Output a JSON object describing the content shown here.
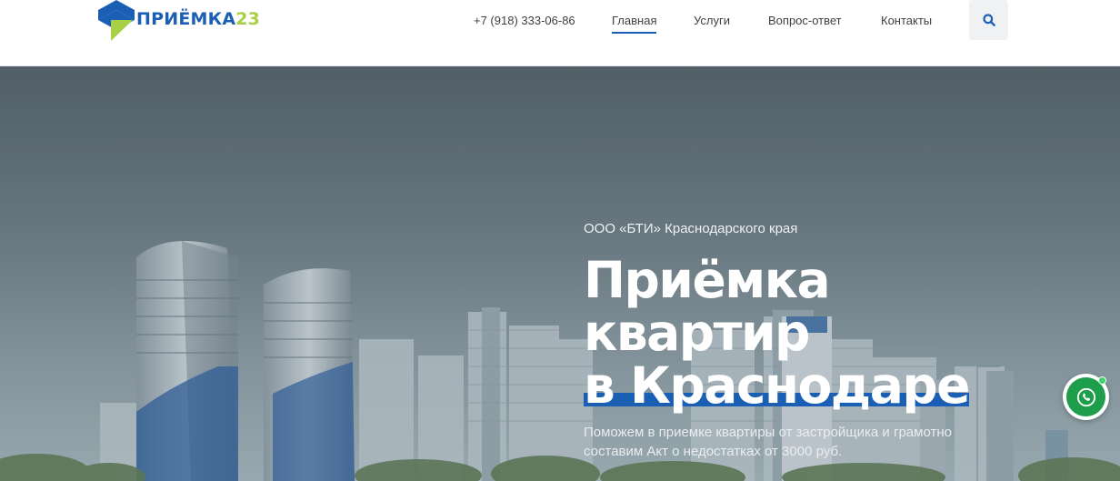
{
  "header": {
    "logo": {
      "word": "ПРИЁМКА",
      "number": "23"
    },
    "phone": "+7 (918) 333-06-86",
    "nav": [
      {
        "label": "Главная",
        "active": true
      },
      {
        "label": "Услуги",
        "active": false
      },
      {
        "label": "Вопрос-ответ",
        "active": false
      },
      {
        "label": "Контакты",
        "active": false
      }
    ],
    "search_icon": "search-icon"
  },
  "hero": {
    "kicker": "ООО «БТИ» Краснодарского края",
    "title_line1": "Приёмка",
    "title_line2": "квартир",
    "title_line3": "в Краснодаре",
    "subtitle": "Поможем в приемке квартиры от застройщика и грамотно составим Акт о недостатках от 3000 руб."
  },
  "widgets": {
    "call_icon": "phone-icon"
  },
  "colors": {
    "brand_blue": "#1a5fb4",
    "brand_green": "#a8d046",
    "call_green": "#1e9d4a"
  }
}
